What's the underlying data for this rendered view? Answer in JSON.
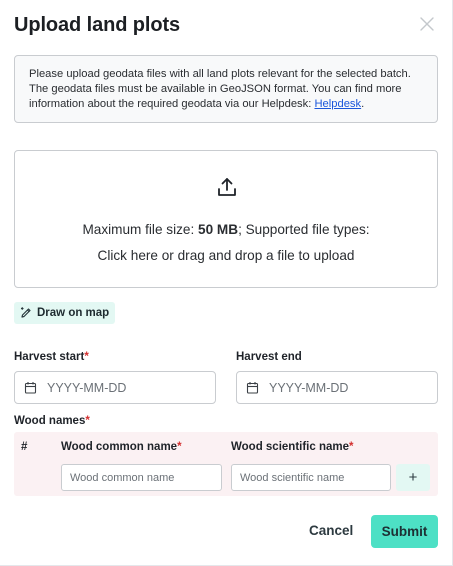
{
  "modal": {
    "title": "Upload land plots",
    "info_text": "Please upload geodata files with all land plots relevant for the selected batch. The geodata files must be available in GeoJSON format. You can find more information about the required geodata via our Helpdesk: ",
    "info_link": "Helpdesk",
    "info_end": "."
  },
  "dropzone": {
    "icon": "upload-icon",
    "size_prefix": "Maximum file size: ",
    "size_value": "50 MB",
    "size_suffix": "; Supported file types:",
    "instruction": "Click here or drag and drop a file to upload"
  },
  "draw_button": {
    "icon": "pencil-icon",
    "label": "Draw on map"
  },
  "harvest_start": {
    "label": "Harvest start",
    "required_mark": "*",
    "placeholder": "YYYY-MM-DD",
    "icon": "calendar-icon"
  },
  "harvest_end": {
    "label": "Harvest end",
    "placeholder": "YYYY-MM-DD",
    "icon": "calendar-icon"
  },
  "wood_names": {
    "label": "Wood names",
    "required_mark": "*",
    "columns": {
      "index": "#",
      "common": "Wood common name",
      "scientific": "Wood scientific name"
    },
    "common_placeholder": "Wood common name",
    "scientific_placeholder": "Wood scientific name",
    "add_label": "+"
  },
  "footer": {
    "cancel": "Cancel",
    "submit": "Submit"
  },
  "colors": {
    "accent": "#4de0c5",
    "accent_light": "#e3f8f3",
    "required": "#d32f2f",
    "link": "#1a56db",
    "table_bg": "#fbf1f3"
  }
}
